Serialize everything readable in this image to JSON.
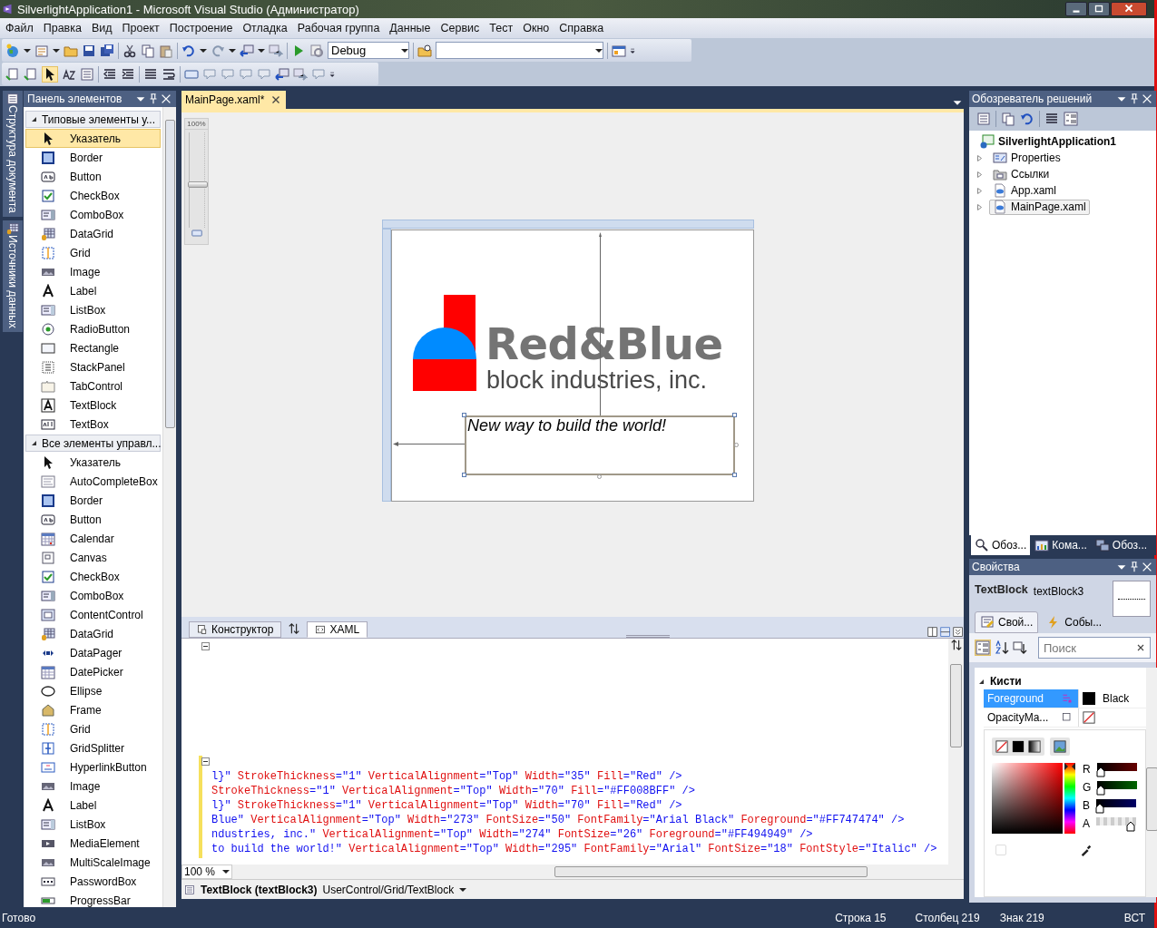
{
  "window": {
    "title": "SilverlightApplication1 - Microsoft Visual Studio (Администратор)"
  },
  "menu": [
    "Файл",
    "Правка",
    "Вид",
    "Проект",
    "Построение",
    "Отладка",
    "Рабочая группа",
    "Данные",
    "Сервис",
    "Тест",
    "Окно",
    "Справка"
  ],
  "toolbar": {
    "configuration": "Debug"
  },
  "side_tabs": [
    "Структура документа",
    "Источники данных"
  ],
  "toolbox": {
    "title": "Панель элементов",
    "groups": [
      {
        "title": "Типовые элементы у...",
        "expanded": true,
        "items": [
          {
            "label": "Указатель",
            "selected": true
          },
          {
            "label": "Border",
            "selected": false
          },
          {
            "label": "Button",
            "selected": false
          },
          {
            "label": "CheckBox",
            "selected": false
          },
          {
            "label": "ComboBox",
            "selected": false
          },
          {
            "label": "DataGrid",
            "selected": false
          },
          {
            "label": "Grid",
            "selected": false
          },
          {
            "label": "Image",
            "selected": false
          },
          {
            "label": "Label",
            "selected": false
          },
          {
            "label": "ListBox",
            "selected": false
          },
          {
            "label": "RadioButton",
            "selected": false
          },
          {
            "label": "Rectangle",
            "selected": false
          },
          {
            "label": "StackPanel",
            "selected": false
          },
          {
            "label": "TabControl",
            "selected": false
          },
          {
            "label": "TextBlock",
            "selected": false
          },
          {
            "label": "TextBox",
            "selected": false
          }
        ]
      },
      {
        "title": "Все элементы управл...",
        "expanded": true,
        "items": [
          {
            "label": "Указатель",
            "selected": false
          },
          {
            "label": "AutoCompleteBox",
            "selected": false
          },
          {
            "label": "Border",
            "selected": false
          },
          {
            "label": "Button",
            "selected": false
          },
          {
            "label": "Calendar",
            "selected": false
          },
          {
            "label": "Canvas",
            "selected": false
          },
          {
            "label": "CheckBox",
            "selected": false
          },
          {
            "label": "ComboBox",
            "selected": false
          },
          {
            "label": "ContentControl",
            "selected": false
          },
          {
            "label": "DataGrid",
            "selected": false
          },
          {
            "label": "DataPager",
            "selected": false
          },
          {
            "label": "DatePicker",
            "selected": false
          },
          {
            "label": "Ellipse",
            "selected": false
          },
          {
            "label": "Frame",
            "selected": false
          },
          {
            "label": "Grid",
            "selected": false
          },
          {
            "label": "GridSplitter",
            "selected": false
          },
          {
            "label": "HyperlinkButton",
            "selected": false
          },
          {
            "label": "Image",
            "selected": false
          },
          {
            "label": "Label",
            "selected": false
          },
          {
            "label": "ListBox",
            "selected": false
          },
          {
            "label": "MediaElement",
            "selected": false
          },
          {
            "label": "MultiScaleImage",
            "selected": false
          },
          {
            "label": "PasswordBox",
            "selected": false
          },
          {
            "label": "ProgressBar",
            "selected": false
          }
        ]
      }
    ]
  },
  "document": {
    "tabs": [
      {
        "label": "MainPage.xaml*",
        "selected": true
      }
    ],
    "zoom_slider": {
      "label": "100%",
      "level": 0.45
    },
    "design": {
      "title": "Red&Blue",
      "subtitle": "block industries, inc.",
      "selected_text": "New way to build the world!"
    },
    "view_tabs": [
      {
        "label": "Конструктор",
        "selected": false
      },
      {
        "label": "XAML",
        "selected": true
      }
    ],
    "code_lines": [
      "l}\" StrokeThickness=\"1\" VerticalAlignment=\"Top\" Width=\"35\" Fill=\"Red\" />",
      "StrokeThickness=\"1\" VerticalAlignment=\"Top\" Width=\"70\" Fill=\"#FF008BFF\" />",
      "l}\" StrokeThickness=\"1\" VerticalAlignment=\"Top\" Width=\"70\" Fill=\"Red\" />",
      "Blue\" VerticalAlignment=\"Top\" Width=\"273\" FontSize=\"50\" FontFamily=\"Arial Black\" Foreground=\"#FF747474\" />",
      "ndustries, inc.\" VerticalAlignment=\"Top\" Width=\"274\" FontSize=\"26\" Foreground=\"#FF494949\" />",
      "to build the world!\" VerticalAlignment=\"Top\" Width=\"295\" FontFamily=\"Arial\" FontSize=\"18\" FontStyle=\"Italic\" />"
    ],
    "zoom": "100 %",
    "breadcrumb": {
      "element": "TextBlock (textBlock3)",
      "path": "UserControl/Grid/TextBlock"
    }
  },
  "solution_explorer": {
    "title": "Обозреватель решений",
    "tree": [
      {
        "label": "SilverlightApplication1",
        "selected": false,
        "children": [
          {
            "label": "Properties",
            "expanded": false,
            "selected": false
          },
          {
            "label": "Ссылки",
            "expanded": false,
            "selected": false
          },
          {
            "label": "App.xaml",
            "expanded": false,
            "selected": false
          },
          {
            "label": "MainPage.xaml",
            "expanded": false,
            "selected": true
          }
        ]
      }
    ],
    "tabs": [
      {
        "label": "Обоз...",
        "selected": true
      },
      {
        "label": "Кома...",
        "selected": false
      },
      {
        "label": "Обоз...",
        "selected": false
      }
    ]
  },
  "properties": {
    "title": "Свойства",
    "type": "TextBlock",
    "name": "textBlock3",
    "tabs": [
      {
        "label": "Свой...",
        "selected": true
      },
      {
        "label": "Собы...",
        "selected": false
      }
    ],
    "search": {
      "placeholder": "Поиск"
    },
    "category": {
      "label": "Кисти",
      "expanded": true
    },
    "rows": [
      {
        "name": "Foreground",
        "selected": true,
        "value": "Black",
        "color": "#000000"
      },
      {
        "name": "OpacityMa...",
        "selected": false
      }
    ],
    "channels": [
      {
        "label": "R",
        "kind": "color",
        "level": 0
      },
      {
        "label": "G",
        "kind": "color",
        "level": 0
      },
      {
        "label": "B",
        "kind": "color",
        "level": 0
      },
      {
        "label": "A",
        "kind": "alpha",
        "level": 1
      }
    ],
    "hue_slider": {
      "level": 1
    },
    "color_checkbox": {
      "checked": false
    }
  },
  "status_bar": {
    "message": "Готово",
    "line": "Строка 15",
    "column": "Столбец 219",
    "char": "Знак 219",
    "mode": "ВСТ"
  }
}
